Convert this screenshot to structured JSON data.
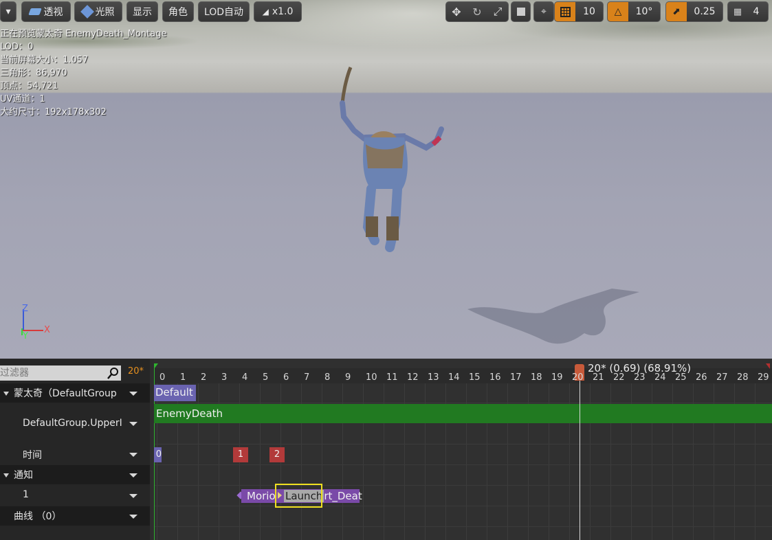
{
  "toolbar": {
    "perspective": "透视",
    "lit": "光照",
    "show": "显示",
    "character": "角色",
    "lod": "LOD自动",
    "speed": "x1.0",
    "grid_size": "10",
    "rotation_snap": "10°",
    "scale_snap": "0.25",
    "camera_speed": "4"
  },
  "stats": {
    "preview": "正在预览蒙太奇 EnemyDeath_Montage",
    "lod": "LOD：0",
    "screen_size": "当前屏幕大小：1.057",
    "triangles": "三角形：86,970",
    "vertices": "顶点：54,721",
    "uv_channels": "UV通道：1",
    "approx_size": "大约尺寸：192x178x302"
  },
  "axis": {
    "z": "Z",
    "y": "Y",
    "x": "X"
  },
  "timeline": {
    "filter_placeholder": "过滤器",
    "current_frame": "20*",
    "scrub_label": "20* (0.69) (68.91%)",
    "ticks": [
      "0",
      "1",
      "2",
      "3",
      "4",
      "5",
      "6",
      "7",
      "8",
      "9",
      "10",
      "11",
      "12",
      "13",
      "14",
      "15",
      "16",
      "17",
      "18",
      "19",
      "20",
      "21",
      "22",
      "23",
      "24",
      "25",
      "26",
      "27",
      "28",
      "29"
    ],
    "tracks": {
      "montage": "蒙太奇（DefaultGroup",
      "slot": "DefaultGroup.UpperI",
      "timing": "时间",
      "notifies": "通知",
      "notify_track": "1",
      "curves": "曲线 （0）"
    },
    "section_label": "Default",
    "segment_label": "EnemyDeath",
    "timing_markers": [
      "0",
      "1",
      "2"
    ],
    "notify_1": "Morio",
    "notify_2": "Launch",
    "notify_2_tail": "rt_Deat"
  }
}
